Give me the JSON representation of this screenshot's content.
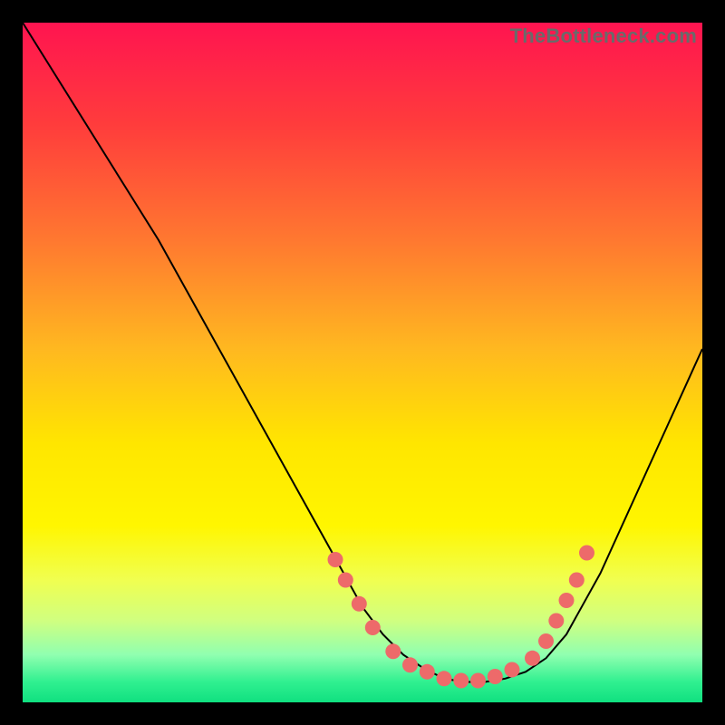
{
  "watermark": "TheBottleneck.com",
  "chart_data": {
    "type": "line",
    "title": "",
    "xlabel": "",
    "ylabel": "",
    "xlim": [
      0,
      100
    ],
    "ylim": [
      0,
      100
    ],
    "series": [
      {
        "name": "bottleneck-curve",
        "x": [
          0,
          5,
          10,
          15,
          20,
          25,
          30,
          35,
          40,
          45,
          50,
          53,
          56,
          59,
          62,
          65,
          68,
          71,
          74,
          77,
          80,
          85,
          90,
          95,
          100
        ],
        "y": [
          100,
          92,
          84,
          76,
          68,
          59,
          50,
          41,
          32,
          23,
          14,
          10,
          7,
          5,
          3.5,
          3,
          3,
          3.5,
          4.5,
          6.5,
          10,
          19,
          30,
          41,
          52
        ]
      }
    ],
    "markers": {
      "name": "highlight-dots",
      "points": [
        {
          "x": 46.0,
          "y": 21.0
        },
        {
          "x": 47.5,
          "y": 18.0
        },
        {
          "x": 49.5,
          "y": 14.5
        },
        {
          "x": 51.5,
          "y": 11.0
        },
        {
          "x": 54.5,
          "y": 7.5
        },
        {
          "x": 57.0,
          "y": 5.5
        },
        {
          "x": 59.5,
          "y": 4.5
        },
        {
          "x": 62.0,
          "y": 3.5
        },
        {
          "x": 64.5,
          "y": 3.2
        },
        {
          "x": 67.0,
          "y": 3.2
        },
        {
          "x": 69.5,
          "y": 3.8
        },
        {
          "x": 72.0,
          "y": 4.8
        },
        {
          "x": 75.0,
          "y": 6.5
        },
        {
          "x": 77.0,
          "y": 9.0
        },
        {
          "x": 78.5,
          "y": 12.0
        },
        {
          "x": 80.0,
          "y": 15.0
        },
        {
          "x": 81.5,
          "y": 18.0
        },
        {
          "x": 83.0,
          "y": 22.0
        }
      ]
    }
  }
}
